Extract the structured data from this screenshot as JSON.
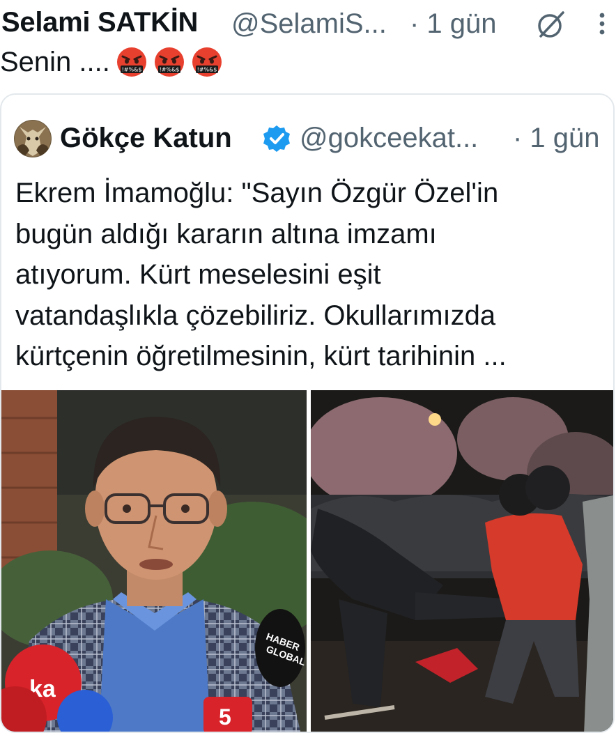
{
  "tweet": {
    "author_name": "Selami SATKİN",
    "author_handle": "@SelamiS...",
    "time": "· 1 gün",
    "text": "Senin ....",
    "emoji_count": 3,
    "emoji_name": "face-with-symbols-on-mouth"
  },
  "quote": {
    "author_name": "Gökçe Katun",
    "author_handle": "@gokceekat...",
    "time": "· 1 gün",
    "verified": true,
    "text_lines": [
      "Ekrem İmamoğlu: \"Sayın Özgür Özel'in",
      "bugün aldığı kararın altına imzamı",
      "atıyorum. Kürt meselesini eşit",
      "vatandaşlıkla çözebiliriz. Okullarımızda",
      "kürtçenin öğretilmesinin, kürt tarihinin ..."
    ],
    "media": [
      {
        "name": "press-photo",
        "mic_labels": [
          "HABER",
          "GLOBAL",
          "ka",
          "5"
        ]
      },
      {
        "name": "protest-photo"
      }
    ]
  },
  "icons": {
    "grok": "grok-icon",
    "more": "more-vertical-icon",
    "verified": "verified-badge-icon"
  },
  "colors": {
    "secondary_text": "#536471",
    "verified_blue": "#1d9bf0",
    "card_border": "#e3e8ec"
  }
}
